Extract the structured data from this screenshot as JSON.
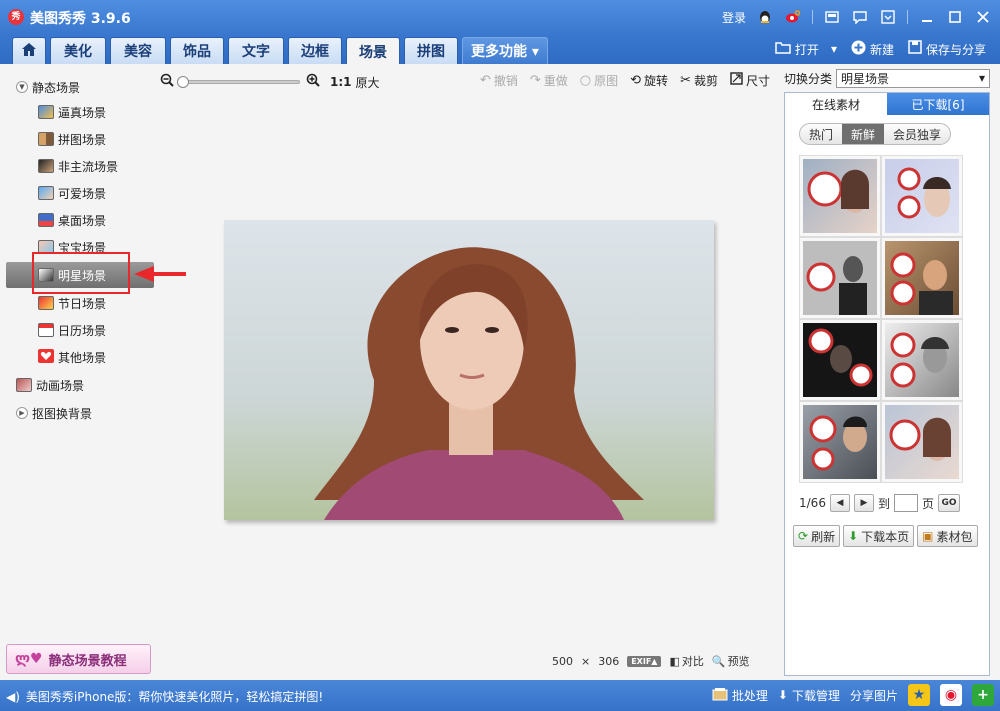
{
  "app": {
    "logo_text": "秀",
    "title": "美图秀秀 3.9.6",
    "login_label": "登录"
  },
  "nav": {
    "tabs": [
      {
        "label": ""
      },
      {
        "label": "美化"
      },
      {
        "label": "美容"
      },
      {
        "label": "饰品"
      },
      {
        "label": "文字"
      },
      {
        "label": "边框"
      },
      {
        "label": "场景"
      },
      {
        "label": "拼图"
      },
      {
        "label": "更多功能 ▾"
      }
    ],
    "active_tab": "场景",
    "open_label": "打开",
    "new_label": "新建",
    "save_label": "保存与分享"
  },
  "tree": {
    "groups": [
      {
        "label": "静态场景",
        "expanded": true
      },
      {
        "label": "动画场景"
      },
      {
        "label": "抠图换背景",
        "expanded": false
      }
    ],
    "items": [
      {
        "label": "逼真场景"
      },
      {
        "label": "拼图场景"
      },
      {
        "label": "非主流场景"
      },
      {
        "label": "可爱场景"
      },
      {
        "label": "桌面场景"
      },
      {
        "label": "宝宝场景"
      },
      {
        "label": "明星场景"
      },
      {
        "label": "节日场景"
      },
      {
        "label": "日历场景"
      },
      {
        "label": "其他场景"
      }
    ],
    "selected_item": "明星场景",
    "highlight_color": "#e9282b"
  },
  "toolbar": {
    "ratio": "1:1",
    "ratio_label": "原大",
    "undo": "撤销",
    "redo": "重做",
    "original": "原图",
    "rotate": "旋转",
    "crop": "裁剪",
    "size": "尺寸"
  },
  "canvas": {
    "width": "500",
    "times": "×",
    "height": "306",
    "exif": "EXIF▲",
    "compare": "对比",
    "preview": "预览"
  },
  "tutorial": {
    "label": "静态场景教程"
  },
  "right_panel": {
    "switch_label": "切换分类",
    "category": "明星场景",
    "tabs": [
      {
        "label": "在线素材"
      },
      {
        "label": "已下载[6]"
      }
    ],
    "pills": [
      {
        "label": "热门"
      },
      {
        "label": "新鲜"
      },
      {
        "label": "会员独享"
      }
    ],
    "active_pill": "新鲜",
    "page_current": "1/66",
    "page_to": "到",
    "page_unit": "页",
    "go": "GO",
    "refresh": "刷新",
    "download_page": "下载本页",
    "material_pack": "素材包"
  },
  "statusbar": {
    "promo": "美图秀秀iPhone版：帮你快速美化照片，轻松搞定拼图!",
    "batch": "批处理",
    "download_mgr": "下载管理",
    "share_photo": "分享图片"
  },
  "colors": {
    "accent": "#3a78cf",
    "selected_row": "#7a7a7a",
    "tab_blue": "#2f74d0"
  }
}
